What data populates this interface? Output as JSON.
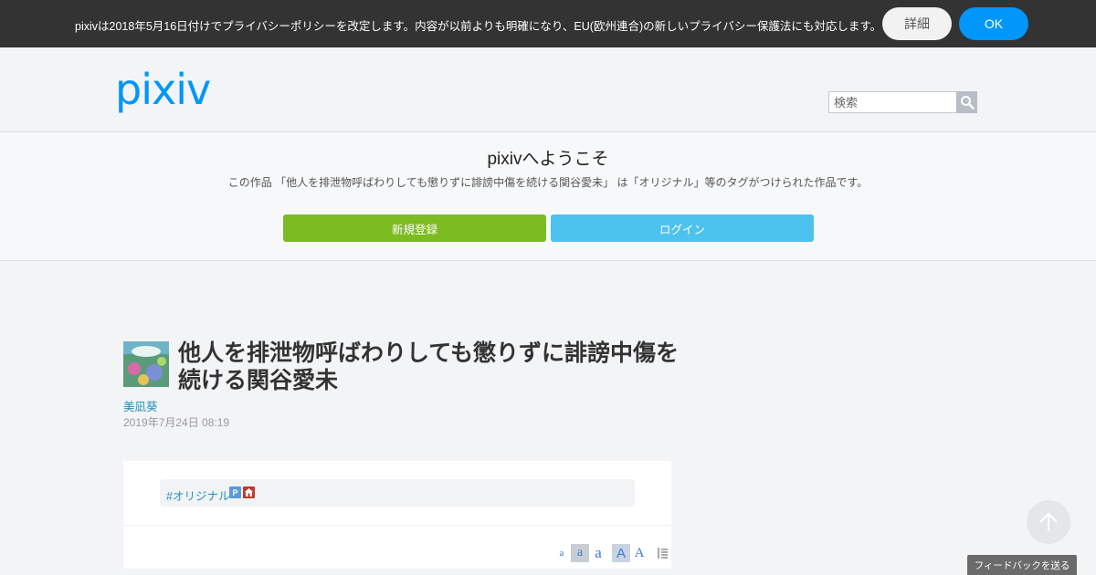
{
  "privacy_bar": {
    "message": "pixivは2018年5月16日付けでプライバシーポリシーを改定します。内容が以前よりも明確になり、EU(欧州連合)の新しいプライバシー保護法にも対応します。",
    "details_label": "詳細",
    "ok_label": "OK"
  },
  "header": {
    "logo_text": "pixiv",
    "search_placeholder": "検索",
    "search_icon": "search-icon"
  },
  "welcome": {
    "title": "pixivへようこそ",
    "description": "この作品 「他人を排泄物呼ばわりしても懲りずに誹謗中傷を続ける関谷愛未」 は「オリジナル」等のタグがつけられた作品です。",
    "signup_label": "新規登録",
    "login_label": "ログイン"
  },
  "work": {
    "title": "他人を排泄物呼ばわりしても懲りずに誹謗中傷を続ける関谷愛未",
    "author": "美凪葵",
    "date": "2019年7月24日 08:19",
    "tags": [
      {
        "label": "#オリジナル"
      }
    ],
    "tag_icons": [
      "P",
      "h"
    ]
  },
  "font_controls": [
    "a",
    "a",
    "a",
    "A",
    "A"
  ],
  "feedback_label": "フィードバックを送る",
  "colors": {
    "accent_blue": "#0096fa",
    "signup_green": "#7dbb22",
    "login_blue": "#4cc2ee",
    "link_blue": "#258fb8",
    "privacy_bar_bg": "#333333"
  }
}
